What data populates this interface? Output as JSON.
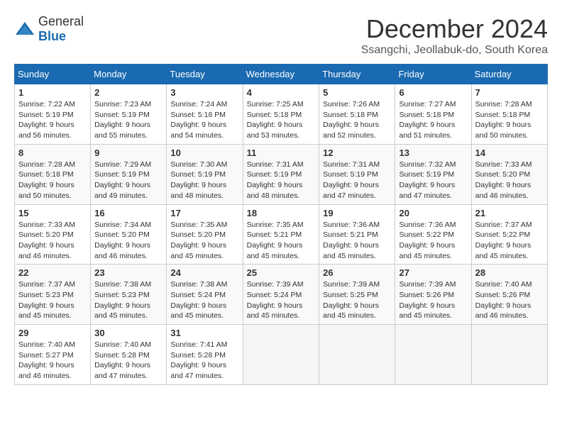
{
  "header": {
    "logo_general": "General",
    "logo_blue": "Blue",
    "month_title": "December 2024",
    "subtitle": "Ssangchi, Jeollabuk-do, South Korea"
  },
  "days_of_week": [
    "Sunday",
    "Monday",
    "Tuesday",
    "Wednesday",
    "Thursday",
    "Friday",
    "Saturday"
  ],
  "weeks": [
    [
      {
        "day": "1",
        "sunrise": "Sunrise: 7:22 AM",
        "sunset": "Sunset: 5:19 PM",
        "daylight": "Daylight: 9 hours and 56 minutes."
      },
      {
        "day": "2",
        "sunrise": "Sunrise: 7:23 AM",
        "sunset": "Sunset: 5:19 PM",
        "daylight": "Daylight: 9 hours and 55 minutes."
      },
      {
        "day": "3",
        "sunrise": "Sunrise: 7:24 AM",
        "sunset": "Sunset: 5:18 PM",
        "daylight": "Daylight: 9 hours and 54 minutes."
      },
      {
        "day": "4",
        "sunrise": "Sunrise: 7:25 AM",
        "sunset": "Sunset: 5:18 PM",
        "daylight": "Daylight: 9 hours and 53 minutes."
      },
      {
        "day": "5",
        "sunrise": "Sunrise: 7:26 AM",
        "sunset": "Sunset: 5:18 PM",
        "daylight": "Daylight: 9 hours and 52 minutes."
      },
      {
        "day": "6",
        "sunrise": "Sunrise: 7:27 AM",
        "sunset": "Sunset: 5:18 PM",
        "daylight": "Daylight: 9 hours and 51 minutes."
      },
      {
        "day": "7",
        "sunrise": "Sunrise: 7:28 AM",
        "sunset": "Sunset: 5:18 PM",
        "daylight": "Daylight: 9 hours and 50 minutes."
      }
    ],
    [
      {
        "day": "8",
        "sunrise": "Sunrise: 7:28 AM",
        "sunset": "Sunset: 5:18 PM",
        "daylight": "Daylight: 9 hours and 50 minutes."
      },
      {
        "day": "9",
        "sunrise": "Sunrise: 7:29 AM",
        "sunset": "Sunset: 5:19 PM",
        "daylight": "Daylight: 9 hours and 49 minutes."
      },
      {
        "day": "10",
        "sunrise": "Sunrise: 7:30 AM",
        "sunset": "Sunset: 5:19 PM",
        "daylight": "Daylight: 9 hours and 48 minutes."
      },
      {
        "day": "11",
        "sunrise": "Sunrise: 7:31 AM",
        "sunset": "Sunset: 5:19 PM",
        "daylight": "Daylight: 9 hours and 48 minutes."
      },
      {
        "day": "12",
        "sunrise": "Sunrise: 7:31 AM",
        "sunset": "Sunset: 5:19 PM",
        "daylight": "Daylight: 9 hours and 47 minutes."
      },
      {
        "day": "13",
        "sunrise": "Sunrise: 7:32 AM",
        "sunset": "Sunset: 5:19 PM",
        "daylight": "Daylight: 9 hours and 47 minutes."
      },
      {
        "day": "14",
        "sunrise": "Sunrise: 7:33 AM",
        "sunset": "Sunset: 5:20 PM",
        "daylight": "Daylight: 9 hours and 46 minutes."
      }
    ],
    [
      {
        "day": "15",
        "sunrise": "Sunrise: 7:33 AM",
        "sunset": "Sunset: 5:20 PM",
        "daylight": "Daylight: 9 hours and 46 minutes."
      },
      {
        "day": "16",
        "sunrise": "Sunrise: 7:34 AM",
        "sunset": "Sunset: 5:20 PM",
        "daylight": "Daylight: 9 hours and 46 minutes."
      },
      {
        "day": "17",
        "sunrise": "Sunrise: 7:35 AM",
        "sunset": "Sunset: 5:20 PM",
        "daylight": "Daylight: 9 hours and 45 minutes."
      },
      {
        "day": "18",
        "sunrise": "Sunrise: 7:35 AM",
        "sunset": "Sunset: 5:21 PM",
        "daylight": "Daylight: 9 hours and 45 minutes."
      },
      {
        "day": "19",
        "sunrise": "Sunrise: 7:36 AM",
        "sunset": "Sunset: 5:21 PM",
        "daylight": "Daylight: 9 hours and 45 minutes."
      },
      {
        "day": "20",
        "sunrise": "Sunrise: 7:36 AM",
        "sunset": "Sunset: 5:22 PM",
        "daylight": "Daylight: 9 hours and 45 minutes."
      },
      {
        "day": "21",
        "sunrise": "Sunrise: 7:37 AM",
        "sunset": "Sunset: 5:22 PM",
        "daylight": "Daylight: 9 hours and 45 minutes."
      }
    ],
    [
      {
        "day": "22",
        "sunrise": "Sunrise: 7:37 AM",
        "sunset": "Sunset: 5:23 PM",
        "daylight": "Daylight: 9 hours and 45 minutes."
      },
      {
        "day": "23",
        "sunrise": "Sunrise: 7:38 AM",
        "sunset": "Sunset: 5:23 PM",
        "daylight": "Daylight: 9 hours and 45 minutes."
      },
      {
        "day": "24",
        "sunrise": "Sunrise: 7:38 AM",
        "sunset": "Sunset: 5:24 PM",
        "daylight": "Daylight: 9 hours and 45 minutes."
      },
      {
        "day": "25",
        "sunrise": "Sunrise: 7:39 AM",
        "sunset": "Sunset: 5:24 PM",
        "daylight": "Daylight: 9 hours and 45 minutes."
      },
      {
        "day": "26",
        "sunrise": "Sunrise: 7:39 AM",
        "sunset": "Sunset: 5:25 PM",
        "daylight": "Daylight: 9 hours and 45 minutes."
      },
      {
        "day": "27",
        "sunrise": "Sunrise: 7:39 AM",
        "sunset": "Sunset: 5:26 PM",
        "daylight": "Daylight: 9 hours and 45 minutes."
      },
      {
        "day": "28",
        "sunrise": "Sunrise: 7:40 AM",
        "sunset": "Sunset: 5:26 PM",
        "daylight": "Daylight: 9 hours and 46 minutes."
      }
    ],
    [
      {
        "day": "29",
        "sunrise": "Sunrise: 7:40 AM",
        "sunset": "Sunset: 5:27 PM",
        "daylight": "Daylight: 9 hours and 46 minutes."
      },
      {
        "day": "30",
        "sunrise": "Sunrise: 7:40 AM",
        "sunset": "Sunset: 5:28 PM",
        "daylight": "Daylight: 9 hours and 47 minutes."
      },
      {
        "day": "31",
        "sunrise": "Sunrise: 7:41 AM",
        "sunset": "Sunset: 5:28 PM",
        "daylight": "Daylight: 9 hours and 47 minutes."
      },
      null,
      null,
      null,
      null
    ]
  ]
}
